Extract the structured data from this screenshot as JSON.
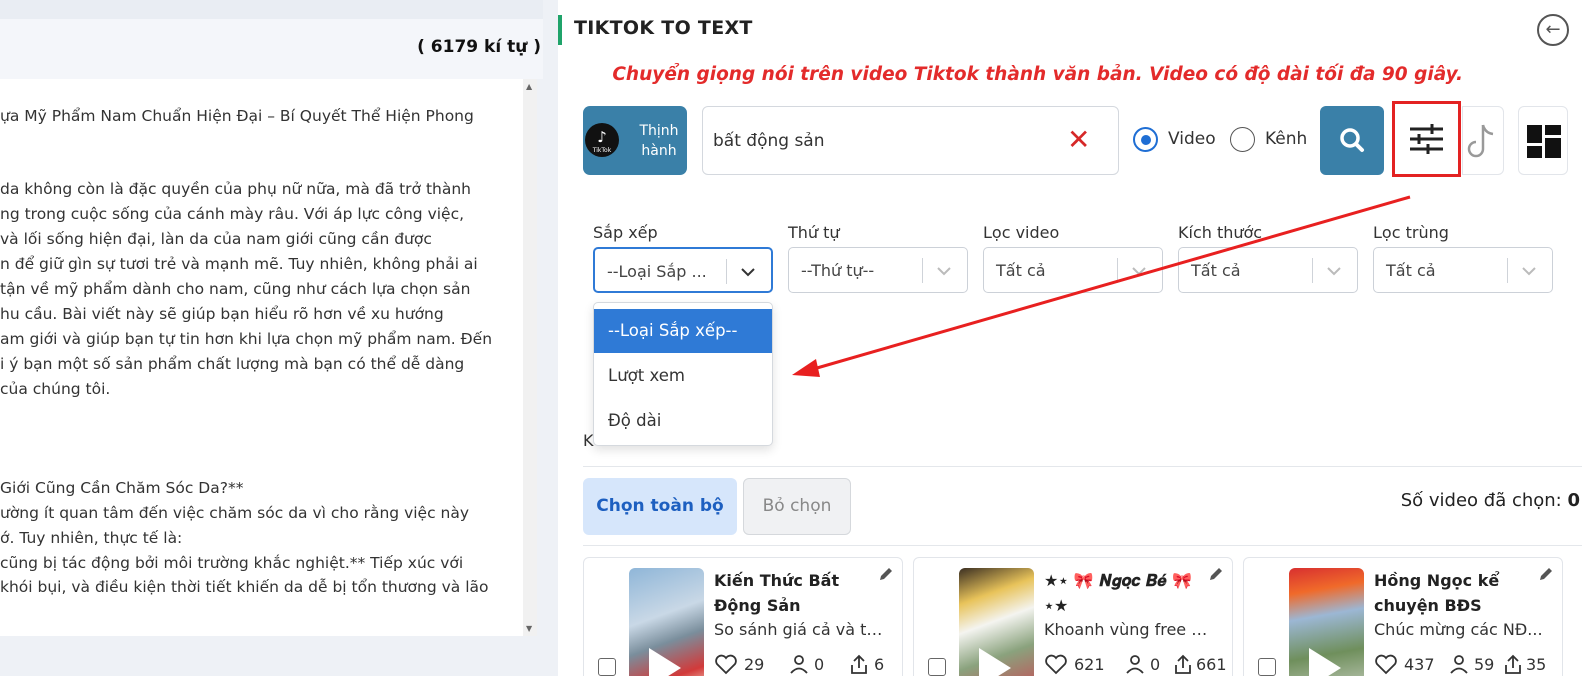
{
  "left_panel": {
    "char_count": "( 6179 kí tự )",
    "lines": [
      "ựa Mỹ Phẩm Nam Chuẩn Hiện Đại – Bí Quyết Thể Hiện Phong",
      "",
      " da không còn là đặc quyền của phụ nữ nữa, mà đã trở thành",
      "ng trong cuộc sống của cánh mày râu. Với áp lực công việc,",
      " và lối sống hiện đại, làn da của nam giới cũng cần được",
      "n để giữ gìn sự tươi trẻ và mạnh mẽ. Tuy nhiên, không phải ai",
      " tận về mỹ phẩm dành cho nam, cũng như cách lựa chọn sản",
      "hu cầu. Bài viết này sẽ giúp bạn hiểu rõ hơn về xu hướng",
      "am giới và giúp bạn tự tin hơn khi lựa chọn mỹ phẩm nam. Đến",
      "i ý bạn một số sản phẩm chất lượng mà bạn có thể dễ dàng",
      "của chúng tôi.",
      " Giới Cũng Cần Chăm Sóc Da?**",
      "ường ít quan tâm đến việc chăm sóc da vì cho rằng việc này",
      "ớ. Tuy nhiên, thực tế là:",
      "cũng bị tác động bởi môi trường khắc nghiệt.** Tiếp xúc với",
      "khói bụi, và điều kiện thời tiết khiến da dễ bị tổn thương và lão"
    ]
  },
  "header": {
    "title": "TIKTOK TO TEXT",
    "notice": "Chuyển giọng nói trên video Tiktok thành văn bản. Video có độ dài tối đa 90 giây."
  },
  "trending": {
    "logo_text": "TikTok",
    "label_line1": "Thịnh",
    "label_line2": "hành"
  },
  "search": {
    "value": "bất động sản"
  },
  "search_type": {
    "video_label": "Video",
    "channel_label": "Kênh"
  },
  "filters": {
    "sort_label": "Sắp xếp",
    "sort_value": "--Loại Sắp ...",
    "order_label": "Thứ tự",
    "order_value": "--Thứ tự--",
    "video_filter_label": "Lọc video",
    "video_filter_value": "Tất cả",
    "size_label": "Kích thước",
    "size_value": "Tất cả",
    "dup_label": "Lọc trùng",
    "dup_value": "Tất cả"
  },
  "dropdown_options": [
    "--Loại Sắp xếp--",
    "Lượt xem",
    "Độ dài"
  ],
  "partial_label": "K",
  "selection": {
    "select_all": "Chọn toàn bộ",
    "deselect": "Bỏ chọn",
    "count_label": "Số video đã chọn: ",
    "count_value": "0"
  },
  "videos": [
    {
      "title": "Kiến Thức Bất Động Sản",
      "desc": "So sánh giá cả và ti...",
      "likes": "29",
      "followers": "0",
      "shares": "6"
    },
    {
      "title": "★⋆ 🎀 𝑵𝒈𝒐̣𝒄 𝑩𝒆́ 🎀 ⋆★",
      "desc": "Khoanh vùng free c...",
      "likes": "621",
      "followers": "0",
      "shares": "661"
    },
    {
      "title": "Hồng Ngọc kể chuyện BĐS",
      "desc": "Chúc mừng các NĐ...",
      "likes": "437",
      "followers": "59",
      "shares": "35"
    }
  ],
  "colors": {
    "accent_blue": "#3a80a8",
    "select_blue": "#2f7ad6",
    "notice_red": "#e32b2b",
    "green_bar": "#1fa36a"
  }
}
